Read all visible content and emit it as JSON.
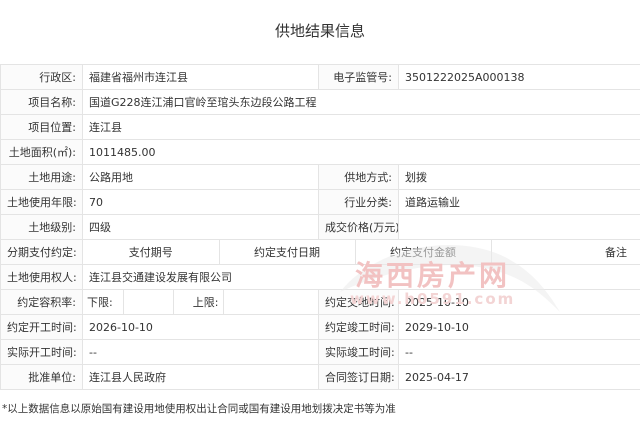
{
  "page_title": "供地结果信息",
  "rows": {
    "district_label": "行政区:",
    "district_value": "福建省福州市连江县",
    "supervision_no_label": "电子监管号:",
    "supervision_no_value": "3501222025A000138",
    "project_name_label": "项目名称:",
    "project_name_value": "国道G228连江浦口官岭至琯头东边段公路工程",
    "project_location_label": "项目位置:",
    "project_location_value": "连江县",
    "land_area_label": "土地面积(㎡):",
    "land_area_value": "1011485.00",
    "land_use_label": "土地用途:",
    "land_use_value": "公路用地",
    "supply_method_label": "供地方式:",
    "supply_method_value": "划拨",
    "use_years_label": "土地使用年限:",
    "use_years_value": "70",
    "industry_label": "行业分类:",
    "industry_value": "道路运输业",
    "land_grade_label": "土地级别:",
    "land_grade_value": "四级",
    "price_label": "成交价格(万元):",
    "price_value": "",
    "installment_label": "分期支付约定:",
    "installment_headers": [
      "支付期号",
      "约定支付日期",
      "约定支付金额",
      "备注"
    ],
    "land_user_label": "土地使用权人:",
    "land_user_value": "连江县交通建设发展有限公司",
    "plot_ratio_label": "约定容积率:",
    "lower_limit_label": "下限:",
    "lower_limit_value": "",
    "upper_limit_label": "上限:",
    "upper_limit_value": "",
    "delivery_date_label": "约定交地时间:",
    "delivery_date_value": "2025-10-10",
    "start_date_label": "约定开工时间:",
    "start_date_value": "2026-10-10",
    "completion_date_label": "约定竣工时间:",
    "completion_date_value": "2029-10-10",
    "actual_start_label": "实际开工时间:",
    "actual_start_value": "--",
    "actual_completion_label": "实际竣工时间:",
    "actual_completion_value": "--",
    "approval_unit_label": "批准单位:",
    "approval_unit_value": "连江县人民政府",
    "contract_date_label": "合同签订日期:",
    "contract_date_value": "2025-04-17"
  },
  "footnote": "*以上数据信息以原始国有建设用地使用权出让合同或国有建设用地划拨决定书等为准",
  "watermark": {
    "text": "海西房产网",
    "url": "www.h0591.com",
    "color": "#e58a8a"
  }
}
